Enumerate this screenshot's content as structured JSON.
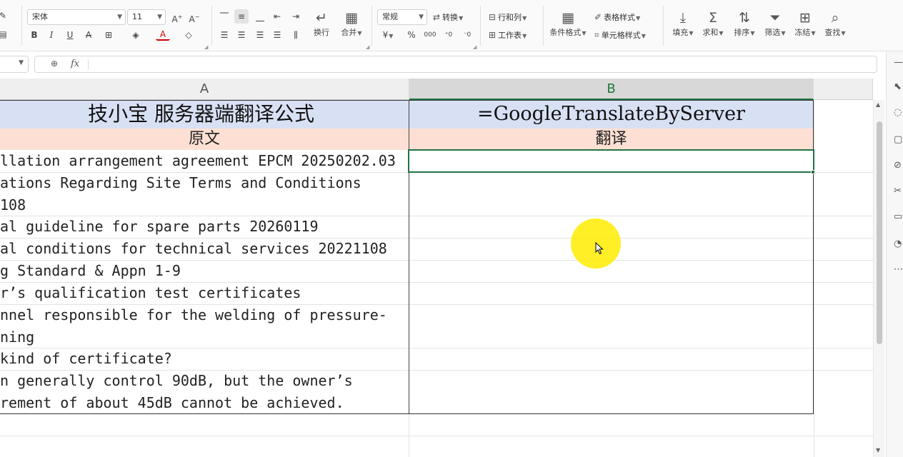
{
  "ribbon": {
    "font_name": "宋体",
    "font_size": "11",
    "number_format": "常规",
    "convert_label": "转换",
    "wrap_label": "换行",
    "merge_label": "合并",
    "row_col_label": "行和列",
    "worksheet_label": "工作表",
    "cond_format_label": "条件格式",
    "table_style_label": "表格样式",
    "cell_style_label": "单元格样式",
    "fill_label": "填充",
    "sum_label": "求和",
    "sort_label": "排序",
    "filter_label": "筛选",
    "freeze_label": "冻结",
    "find_label": "查找",
    "bold": "B",
    "italic": "I",
    "underline": "U",
    "strike": "A",
    "font_color_glyph": "A",
    "percent": "%",
    "currency": "¥"
  },
  "formula_bar": {
    "fx_label": "fx",
    "content": ""
  },
  "columns": [
    {
      "label": "A"
    },
    {
      "label": "B"
    }
  ],
  "sheet": {
    "title_a": "技小宝  服务器端翻译公式",
    "title_b": "=GoogleTranslateByServer",
    "sub_a": "原文",
    "sub_b": "翻译",
    "rows": [
      {
        "lines": [
          "llation arrangement agreement EPCM 20250202.03"
        ]
      },
      {
        "lines": [
          "ations Regarding Site Terms and Conditions",
          "108"
        ]
      },
      {
        "lines": [
          "al guideline for spare parts 20260119"
        ]
      },
      {
        "lines": [
          "al conditions for technical services 20221108"
        ]
      },
      {
        "lines": [
          "g Standard & Appn 1-9"
        ]
      },
      {
        "lines": [
          "r’s qualification test certificates"
        ]
      },
      {
        "lines": [
          "nnel responsible for the welding of pressure-",
          "ning"
        ]
      },
      {
        "lines": [
          " kind of certificate?"
        ]
      },
      {
        "lines": [
          "n generally control 90dB, but the owner’s",
          "rement of about 45dB cannot be achieved."
        ]
      }
    ]
  },
  "colors": {
    "title_row_bg": "#d8e1f4",
    "subtitle_row_bg": "#fde0d3",
    "active_cell_border": "#217346",
    "cursor_halo": "#ffec00"
  }
}
